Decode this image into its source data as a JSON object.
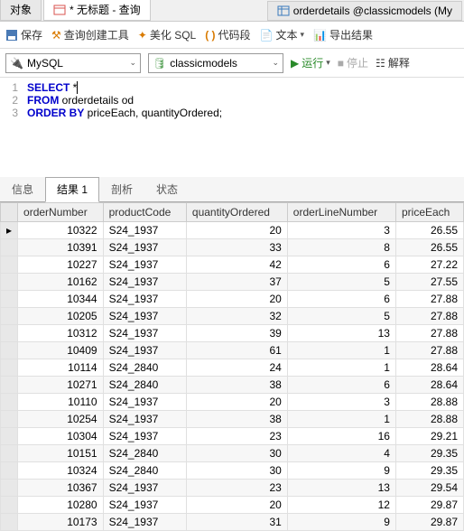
{
  "tabs": {
    "objects": "对象",
    "query": "* 无标题 - 查询",
    "orderdetails": "orderdetails @classicmodels (My"
  },
  "toolbar": {
    "save": "保存",
    "query_builder": "查询创建工具",
    "beautify": "美化 SQL",
    "snippets": "代码段",
    "text": "文本",
    "export": "导出结果"
  },
  "conn": {
    "driver": "MySQL",
    "db": "classicmodels",
    "run": "运行",
    "stop": "停止",
    "explain": "解释"
  },
  "sql": {
    "l1_kw": "SELECT",
    "l1_rest": " *",
    "l2_kw": "FROM",
    "l2_rest": " orderdetails od",
    "l3_kw": "ORDER BY",
    "l3_rest": " priceEach, quantityOrdered;"
  },
  "rtabs": {
    "info": "信息",
    "result": "结果 1",
    "profile": "剖析",
    "status": "状态"
  },
  "cols": [
    "orderNumber",
    "productCode",
    "quantityOrdered",
    "orderLineNumber",
    "priceEach"
  ],
  "rows": [
    [
      10322,
      "S24_1937",
      20,
      3,
      "26.55"
    ],
    [
      10391,
      "S24_1937",
      33,
      8,
      "26.55"
    ],
    [
      10227,
      "S24_1937",
      42,
      6,
      "27.22"
    ],
    [
      10162,
      "S24_1937",
      37,
      5,
      "27.55"
    ],
    [
      10344,
      "S24_1937",
      20,
      6,
      "27.88"
    ],
    [
      10205,
      "S24_1937",
      32,
      5,
      "27.88"
    ],
    [
      10312,
      "S24_1937",
      39,
      13,
      "27.88"
    ],
    [
      10409,
      "S24_1937",
      61,
      1,
      "27.88"
    ],
    [
      10114,
      "S24_2840",
      24,
      1,
      "28.64"
    ],
    [
      10271,
      "S24_2840",
      38,
      6,
      "28.64"
    ],
    [
      10110,
      "S24_1937",
      20,
      3,
      "28.88"
    ],
    [
      10254,
      "S24_1937",
      38,
      1,
      "28.88"
    ],
    [
      10304,
      "S24_1937",
      23,
      16,
      "29.21"
    ],
    [
      10151,
      "S24_2840",
      30,
      4,
      "29.35"
    ],
    [
      10324,
      "S24_2840",
      30,
      9,
      "29.35"
    ],
    [
      10367,
      "S24_1937",
      23,
      13,
      "29.54"
    ],
    [
      10280,
      "S24_1937",
      20,
      12,
      "29.87"
    ],
    [
      10173,
      "S24_1937",
      31,
      9,
      "29.87"
    ]
  ]
}
